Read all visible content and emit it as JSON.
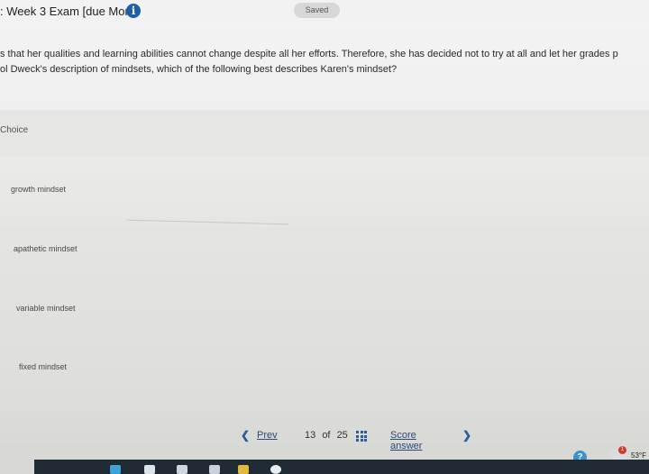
{
  "header": {
    "exam_title": ": Week 3 Exam [due Mon]",
    "info_icon": "info-circle-icon",
    "saved_label": "Saved"
  },
  "question": {
    "line1": "s that her qualities and learning abilities cannot change despite all her efforts. Therefore, she has decided not to try at all and let her grades p",
    "line2": "ol Dweck's description of mindsets, which of the following best describes Karen's mindset?"
  },
  "choices": {
    "header": "Choice",
    "options": [
      {
        "label": "growth mindset"
      },
      {
        "label": "apathetic mindset"
      },
      {
        "label": "variable mindset"
      },
      {
        "label": "fixed mindset"
      }
    ]
  },
  "pager": {
    "prev_label": "Prev",
    "current": "13",
    "of_label": "of",
    "total": "25",
    "score_label": "Score answer",
    "grid_icon": "question-grid-icon",
    "prev_icon": "chevron-left-icon",
    "next_icon": "chevron-right-icon"
  },
  "taskbar": {
    "temperature": "53°F",
    "weather_badge": "1",
    "weather_icon": "cloud-weather-icon",
    "help_icon": "help-circle-icon"
  }
}
